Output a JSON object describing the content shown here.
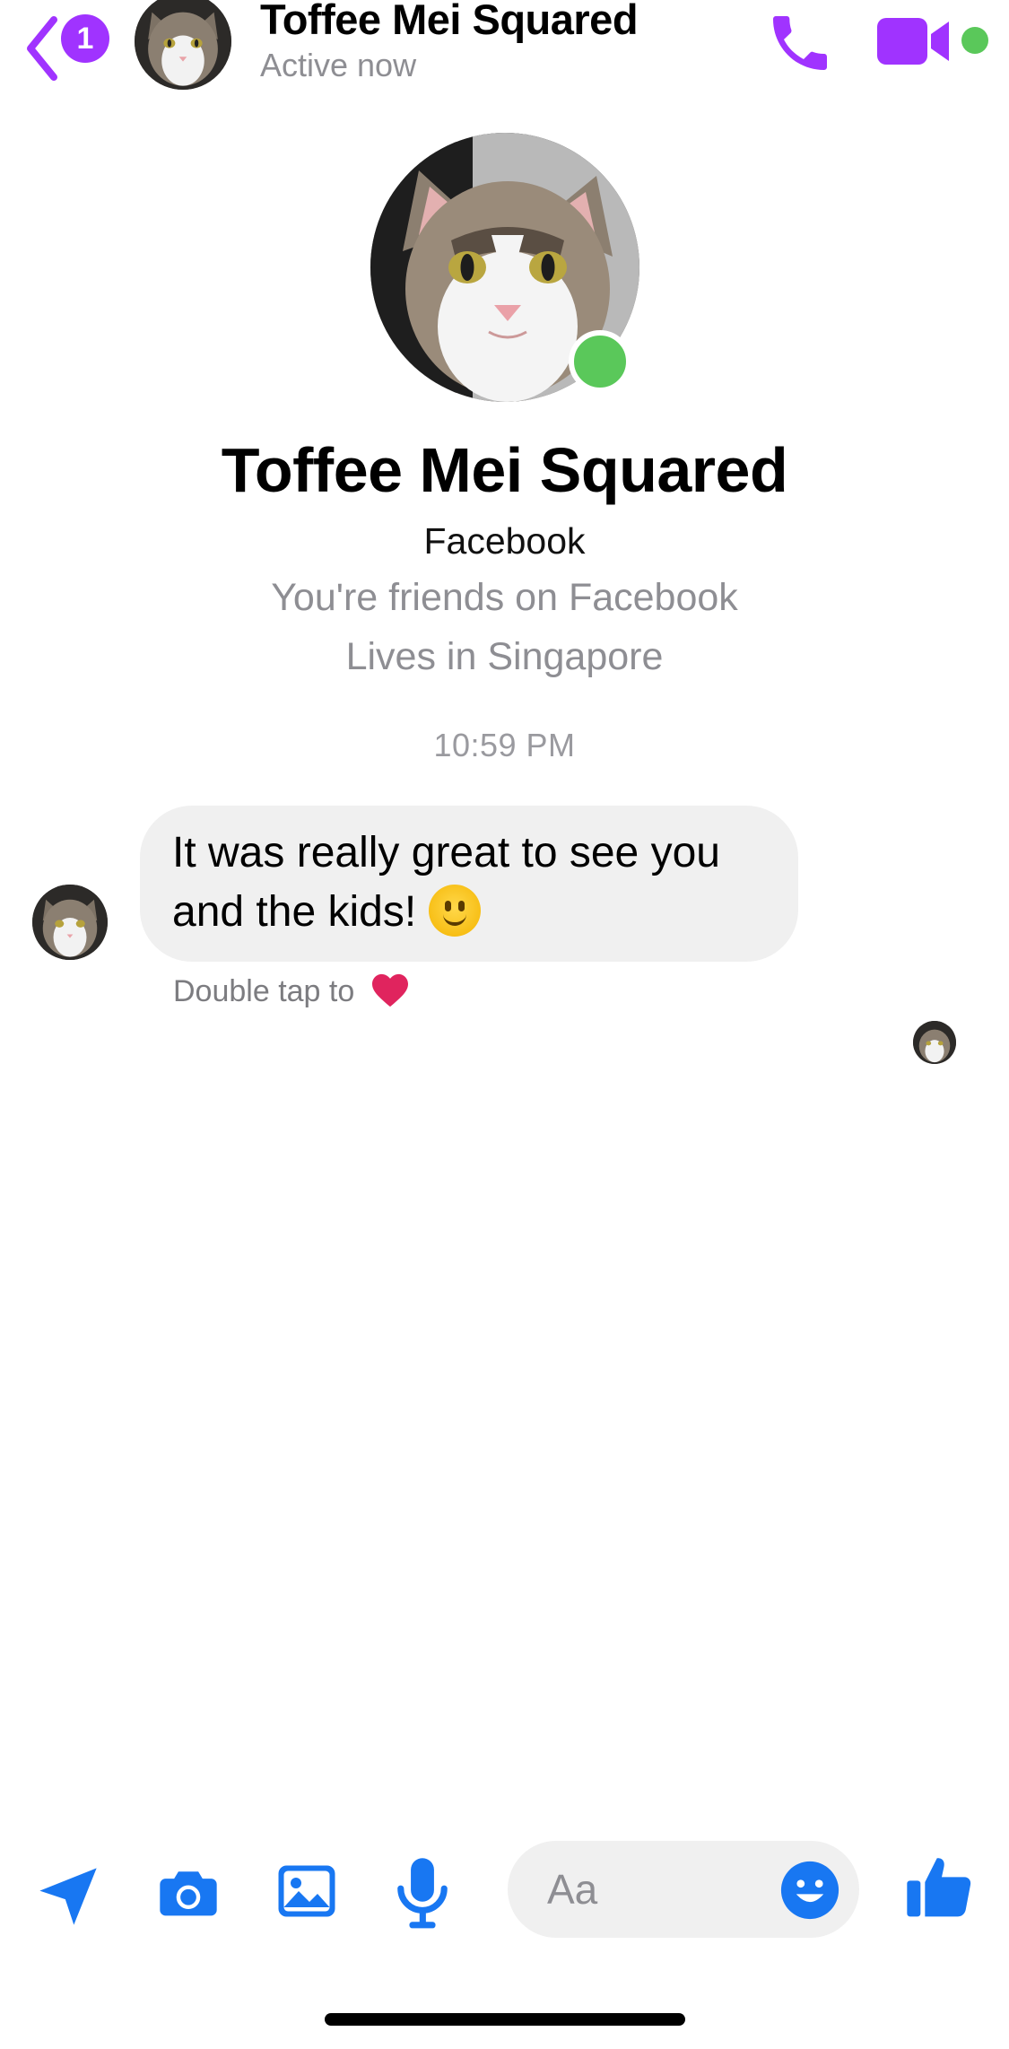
{
  "colors": {
    "accent": "#a033ff",
    "composer_blue": "#1877f2",
    "online": "#5ac85a",
    "heart": "#e0245e"
  },
  "header": {
    "unread_count": "1",
    "contact_name": "Toffee Mei Squared",
    "status": "Active now",
    "icons": [
      "chevron-left-icon",
      "phone-icon",
      "video-camera-icon"
    ]
  },
  "profile": {
    "name": "Toffee Mei Squared",
    "source": "Facebook",
    "friendship": "You're friends on Facebook",
    "location": "Lives in Singapore"
  },
  "conversation": {
    "timestamp": "10:59 PM",
    "messages": [
      {
        "text": "It was really great to see you and the kids!",
        "emoji": "slightly-smiling-face"
      }
    ],
    "reaction_hint": "Double tap to"
  },
  "composer": {
    "placeholder": "Aa",
    "icons": [
      "send-location-icon",
      "camera-icon",
      "gallery-icon",
      "microphone-icon",
      "emoji-icon",
      "thumbs-up-icon"
    ]
  }
}
